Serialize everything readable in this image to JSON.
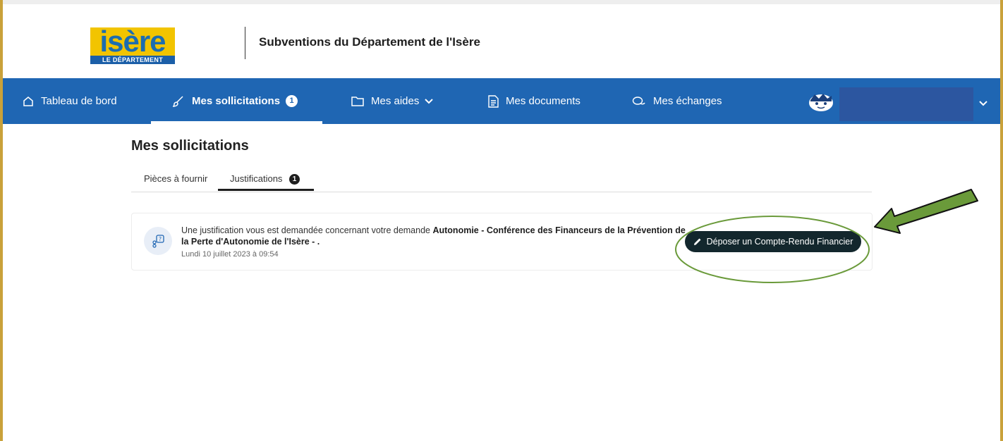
{
  "header": {
    "logo_text": "isère",
    "logo_subtext": "LE DÉPARTEMENT",
    "site_title": "Subventions du Département de l'Isère"
  },
  "nav": {
    "items": [
      {
        "label": "Tableau de bord",
        "icon": "home-icon"
      },
      {
        "label": "Mes sollicitations",
        "icon": "brush-icon",
        "badge": "1",
        "active": true
      },
      {
        "label": "Mes aides",
        "icon": "folder-icon",
        "has_dropdown": true
      },
      {
        "label": "Mes documents",
        "icon": "document-icon"
      },
      {
        "label": "Mes échanges",
        "icon": "chat-icon"
      }
    ],
    "user": {
      "avatar_icon": "avatar-icon",
      "menu_icon": "chevron-down-icon"
    }
  },
  "main": {
    "page_title": "Mes sollicitations",
    "tabs": [
      {
        "label": "Pièces à fournir",
        "active": false
      },
      {
        "label": "Justifications",
        "active": true,
        "badge": "1"
      }
    ],
    "request": {
      "text_prefix": "Une justification vous est demandée concernant votre demande ",
      "text_bold": "Autonomie - Conférence des Financeurs de la Prévention de la Perte d'Autonomie de l'Isère - .",
      "date": "Lundi 10 juillet 2023 à 09:54",
      "icon": "justification-icon",
      "action_label": "Déposer un Compte-Rendu Financier",
      "action_icon": "pencil-icon"
    }
  },
  "colors": {
    "nav_background": "#1f66b3",
    "button_background": "#13272d",
    "annotation_green": "#6a9a3a",
    "logo_yellow": "#f2c400",
    "logo_blue": "#1c6db0"
  }
}
